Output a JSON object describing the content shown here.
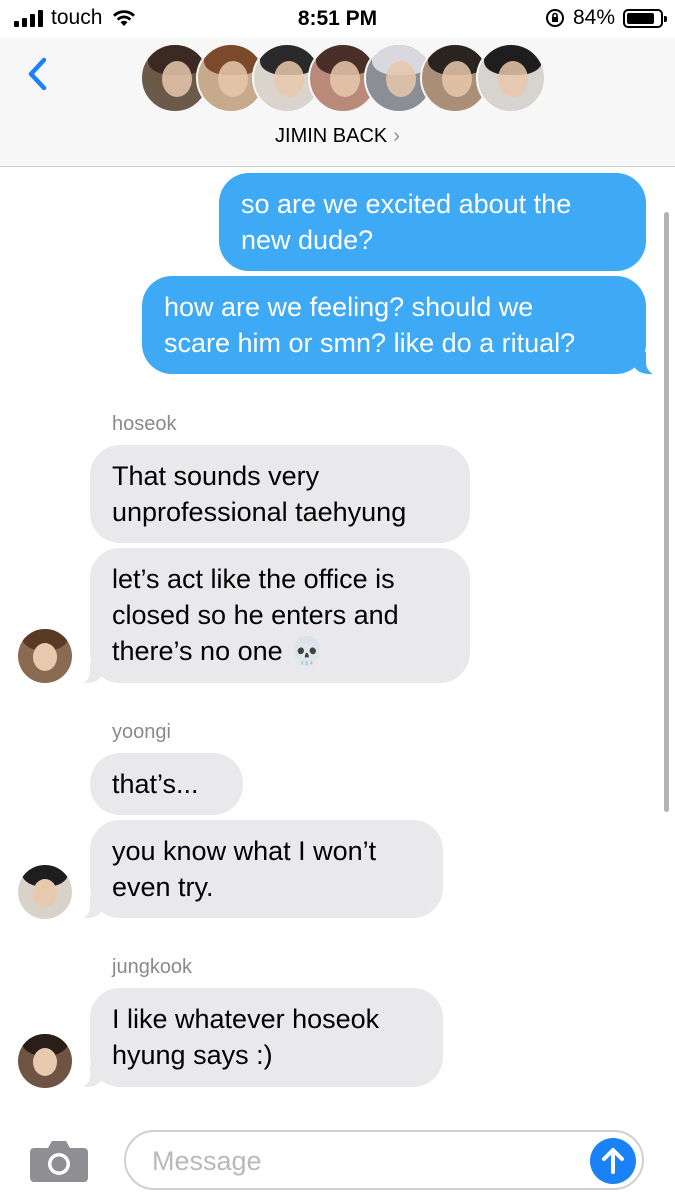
{
  "status_bar": {
    "carrier": "touch",
    "time": "8:51 PM",
    "battery_percent": "84%",
    "battery_level": 0.84,
    "icons": [
      "signal-icon",
      "wifi-icon",
      "orientation-lock-icon",
      "battery-icon"
    ]
  },
  "header": {
    "group_name": "JIMIN BACK",
    "chevron": "›",
    "participant_count": 7,
    "icons": [
      "back-chevron-icon",
      "disclosure-chevron-icon"
    ]
  },
  "messages": {
    "out1": "so are we excited about the\nnew dude?",
    "out2": "how are we feeling? should we\nscare him or smn? like do a ritual?",
    "hoseok": {
      "sender": "hoseok",
      "msg1": "That sounds very\nunprofessional taehyung",
      "msg2": "let’s act like the office is\nclosed so he enters and\nthere’s no one 💀"
    },
    "yoongi": {
      "sender": "yoongi",
      "msg1": "that’s...",
      "msg2": "you know what I won’t\neven try."
    },
    "jungkook": {
      "sender": "jungkook",
      "msg1": "I like whatever hoseok\nhyung says :)"
    }
  },
  "input": {
    "placeholder": "Message",
    "value": "",
    "icons": [
      "camera-icon",
      "send-arrow-icon"
    ]
  },
  "colors": {
    "outgoing_bubble": "#3ea9f5",
    "incoming_bubble": "#e9e9eb",
    "accent": "#1a82f6",
    "header_bg": "#f7f7f7"
  }
}
